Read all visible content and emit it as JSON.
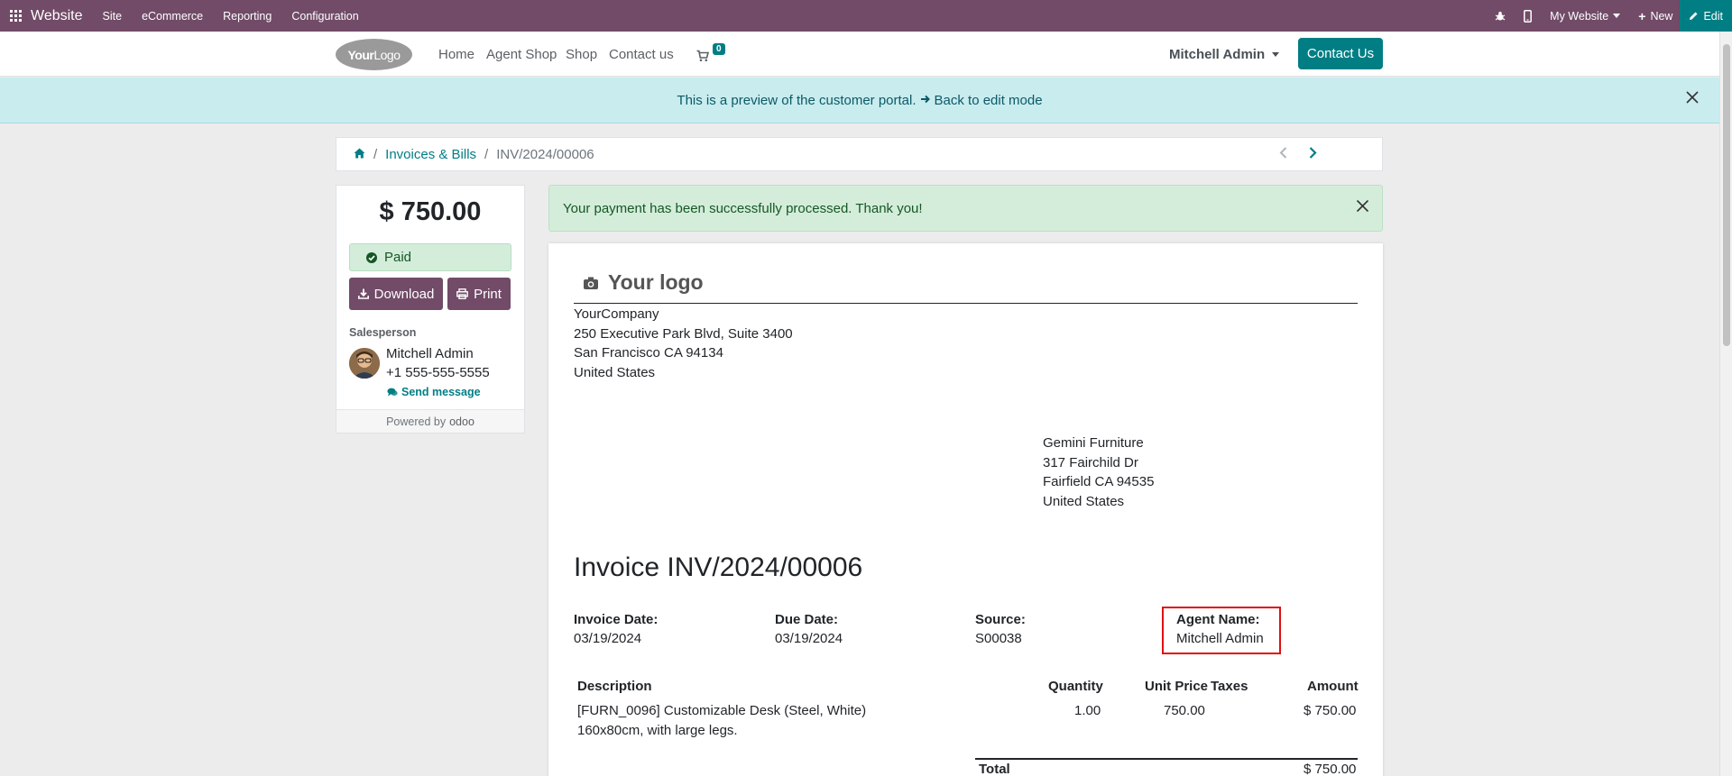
{
  "topbar": {
    "app_name": "Website",
    "menu": [
      "Site",
      "eCommerce",
      "Reporting",
      "Configuration"
    ],
    "website_switcher": "My Website",
    "new_label": "New",
    "edit_label": "Edit"
  },
  "header": {
    "logo_text_bold": "Your",
    "logo_text": "Logo",
    "nav": [
      "Home",
      "Agent Shop",
      "Shop",
      "Contact us"
    ],
    "cart_count": "0",
    "user": "Mitchell Admin",
    "contact_button": "Contact Us"
  },
  "preview_banner": {
    "text": "This is a preview of the customer portal.",
    "link": "Back to edit mode"
  },
  "breadcrumb": {
    "section": "Invoices & Bills",
    "current": "INV/2024/00006"
  },
  "sidebar": {
    "amount": "$ 750.00",
    "status": "Paid",
    "download_label": "Download",
    "print_label": "Print",
    "salesperson_label": "Salesperson",
    "salesperson_name": "Mitchell Admin",
    "salesperson_phone": "+1 555-555-5555",
    "send_message": "Send message",
    "powered_by": "Powered by",
    "powered_brand": "odoo"
  },
  "alert": {
    "text": "Your payment has been successfully processed. Thank you!"
  },
  "invoice": {
    "logo_placeholder": "Your logo",
    "company": {
      "name": "YourCompany",
      "street": "250 Executive Park Blvd, Suite 3400",
      "city": "San Francisco CA 94134",
      "country": "United States"
    },
    "customer": {
      "name": "Gemini Furniture",
      "street": "317 Fairchild Dr",
      "city": "Fairfield CA 94535",
      "country": "United States"
    },
    "title": "Invoice INV/2024/00006",
    "invoice_date_label": "Invoice Date:",
    "invoice_date": "03/19/2024",
    "due_date_label": "Due Date:",
    "due_date": "03/19/2024",
    "source_label": "Source:",
    "source": "S00038",
    "agent_label": "Agent Name:",
    "agent": "Mitchell Admin",
    "columns": {
      "description": "Description",
      "quantity": "Quantity",
      "unit_price": "Unit Price",
      "taxes": "Taxes",
      "amount": "Amount"
    },
    "lines": [
      {
        "description_line1": "[FURN_0096] Customizable Desk (Steel, White)",
        "description_line2": "160x80cm, with large legs.",
        "quantity": "1.00",
        "unit_price": "750.00",
        "taxes": "",
        "amount": "$ 750.00"
      }
    ],
    "total_label": "Total",
    "total": "$ 750.00"
  },
  "colors": {
    "admin_bar": "#714b67",
    "primary": "#017e84",
    "success_bg": "#d4edda",
    "info_bg": "#c9ecef",
    "highlight_border": "#e01010"
  }
}
